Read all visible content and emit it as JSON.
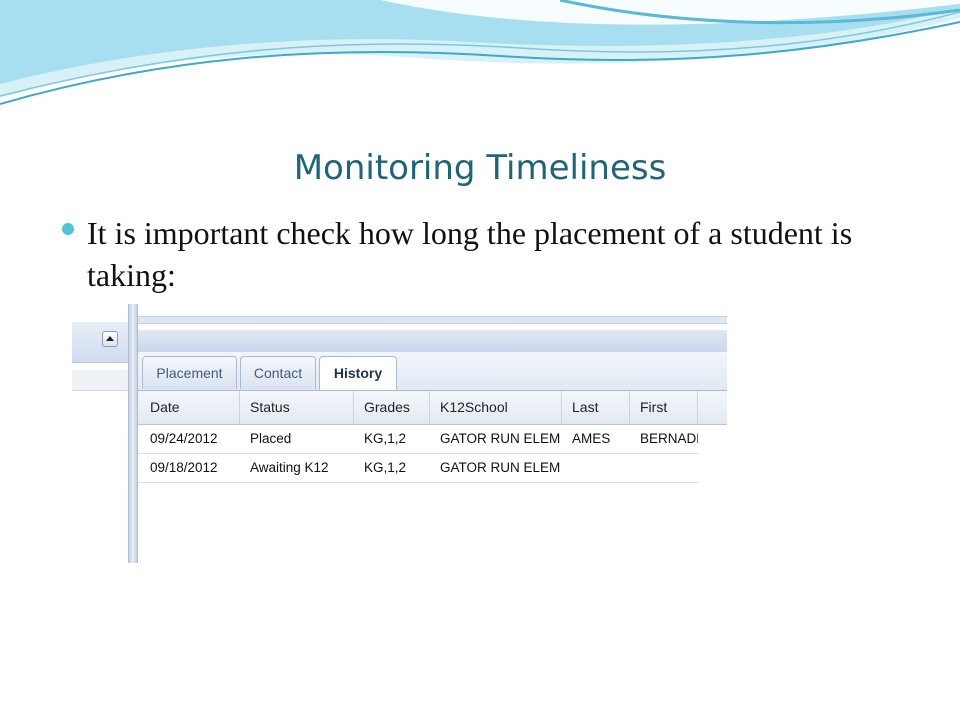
{
  "slide": {
    "title": "Monitoring Timeliness",
    "bullet_text": "It is important check how long the placement of a student is taking:"
  },
  "colors": {
    "title": "#1f6479",
    "bullet": "#4fc3d9",
    "wave_light": "#bfe8f2",
    "wave_dark": "#3fa9c9"
  },
  "icons": {
    "collapse": "triangle-up-icon",
    "bullet": "circle-bullet-icon"
  },
  "app": {
    "tabs": [
      {
        "label": "Placement",
        "active": false
      },
      {
        "label": "Contact",
        "active": false
      },
      {
        "label": "History",
        "active": true
      }
    ],
    "columns": [
      "Date",
      "Status",
      "Grades",
      "K12School",
      "Last",
      "First"
    ],
    "rows": [
      [
        "09/24/2012",
        "Placed",
        "KG,1,2",
        "GATOR RUN ELEM",
        "AMES",
        "BERNADETTE"
      ],
      [
        "09/18/2012",
        "Awaiting K12",
        "KG,1,2",
        "GATOR RUN ELEM",
        "",
        ""
      ]
    ]
  }
}
